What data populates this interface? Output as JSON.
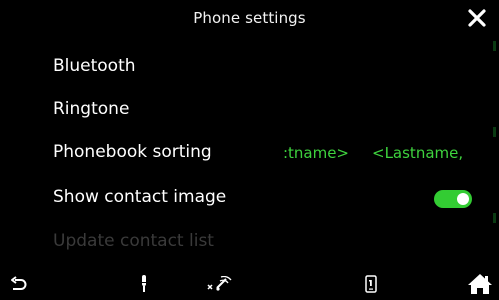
{
  "header": {
    "title": "Phone settings",
    "close_icon": "close-icon"
  },
  "menu": {
    "items": [
      {
        "label": "Bluetooth",
        "enabled": true
      },
      {
        "label": "Ringtone",
        "enabled": true
      },
      {
        "label": "Phonebook sorting",
        "enabled": true
      },
      {
        "label": "Show contact image",
        "enabled": true
      },
      {
        "label": "Update contact list",
        "enabled": false
      }
    ]
  },
  "phonebook_sorting": {
    "options": [
      ":tname>",
      "<Lastname,"
    ],
    "color": "#3ed23e"
  },
  "show_contact_image": {
    "toggle_on": true,
    "color": "#33cc33"
  },
  "bottom_bar": {
    "icons": [
      "back-icon",
      "microphone-icon",
      "no-signal-icon",
      "phone-device-icon",
      "home-icon"
    ]
  }
}
